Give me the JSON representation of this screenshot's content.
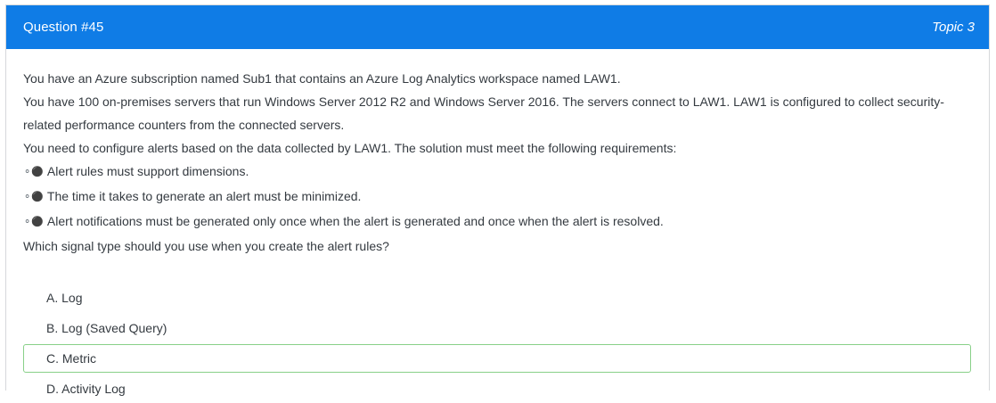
{
  "header": {
    "question_label": "Question #45",
    "topic_label": "Topic 3"
  },
  "question": {
    "lines": [
      "You have an Azure subscription named Sub1 that contains an Azure Log Analytics workspace named LAW1.",
      "You have 100 on-premises servers that run Windows Server 2012 R2 and Windows Server 2016. The servers connect to LAW1. LAW1 is configured to collect security-",
      "related performance counters from the connected servers.",
      "You need to configure alerts based on the data collected by LAW1. The solution must meet the following requirements:"
    ],
    "bullet_glyph": "⚬⚫",
    "requirements": [
      "Alert rules must support dimensions.",
      "The time it takes to generate an alert must be minimized.",
      "Alert notifications must be generated only once when the alert is generated and once when the alert is resolved."
    ],
    "prompt": "Which signal type should you use when you create the alert rules?"
  },
  "choices": [
    {
      "label": "A. Log",
      "correct": false
    },
    {
      "label": "B. Log (Saved Query)",
      "correct": false
    },
    {
      "label": "C. Metric",
      "correct": true
    },
    {
      "label": "D. Activity Log",
      "correct": false
    }
  ],
  "colors": {
    "header_bg": "#0f7ce6",
    "correct_border": "#88d088"
  }
}
